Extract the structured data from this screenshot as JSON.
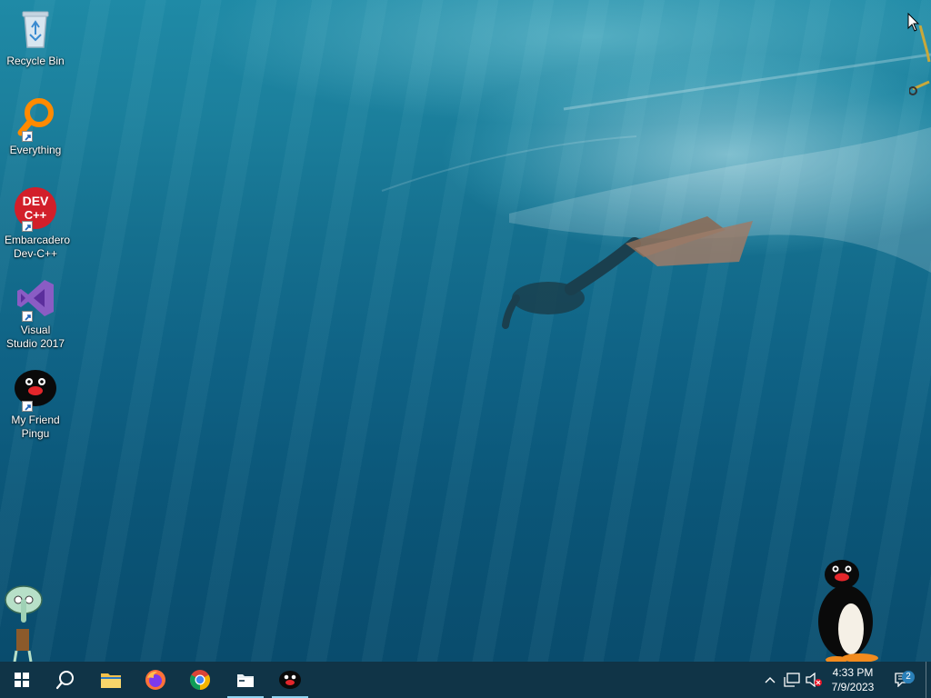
{
  "desktop": {
    "icons": [
      {
        "label": "Recycle Bin",
        "icon": "recycle-bin-icon"
      },
      {
        "label": "Everything",
        "icon": "everything-search-icon"
      },
      {
        "label": "Embarcadero Dev-C++",
        "icon": "dev-cpp-icon",
        "icon_text": "DEV C++"
      },
      {
        "label": "Visual Studio 2017",
        "icon": "visual-studio-icon"
      },
      {
        "label": "My Friend Pingu",
        "icon": "pingu-icon"
      }
    ]
  },
  "taskbar": {
    "pinned": [
      {
        "name": "search",
        "icon": "search-icon"
      },
      {
        "name": "file-explorer",
        "icon": "folder-icon"
      },
      {
        "name": "firefox",
        "icon": "firefox-icon"
      },
      {
        "name": "chrome",
        "icon": "chrome-icon"
      },
      {
        "name": "files-app",
        "icon": "files-icon",
        "active": true
      },
      {
        "name": "pingu",
        "icon": "pingu-icon",
        "active": true
      }
    ],
    "tray": {
      "time": "4:33 PM",
      "date": "7/9/2023",
      "notification_count": "2"
    }
  },
  "colors": {
    "taskbar": "#103447",
    "water_top": "#1f8aa6",
    "water_bottom": "#094c6d",
    "active_indicator": "#8fd3f0"
  }
}
